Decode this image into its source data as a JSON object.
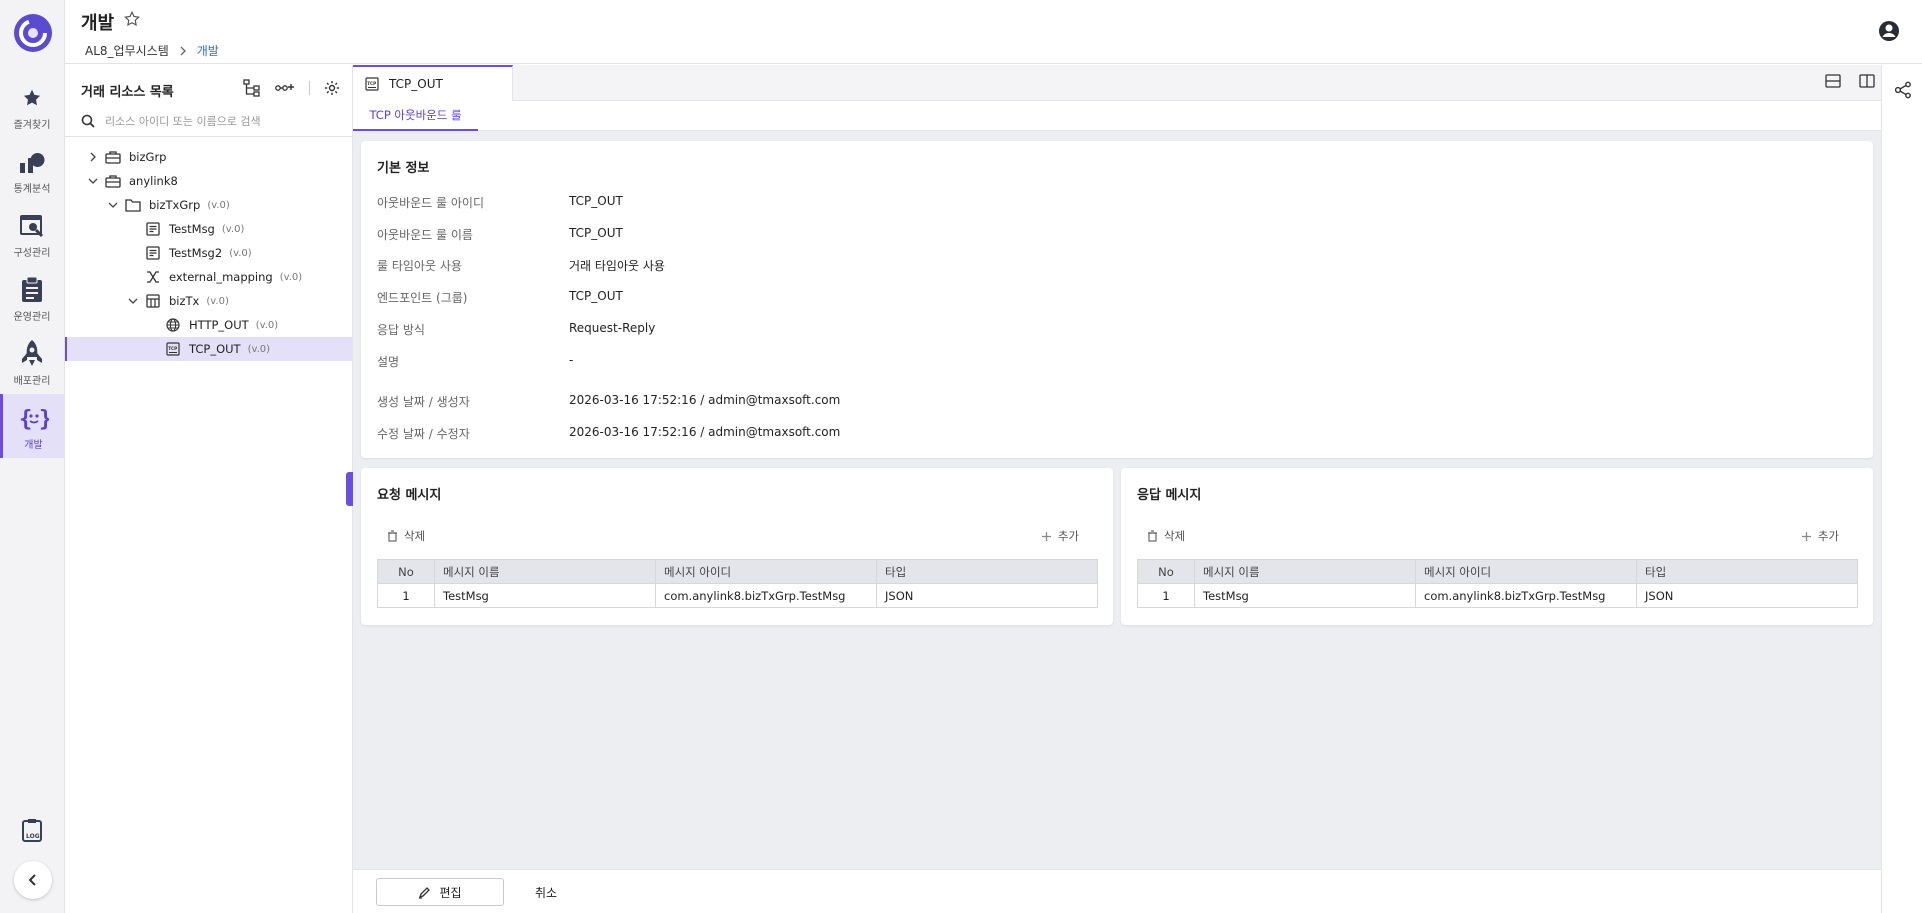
{
  "header": {
    "title": "개발",
    "breadcrumb": [
      "AL8_업무시스템",
      "개발"
    ]
  },
  "rail": {
    "items": [
      {
        "label": "즐겨찾기",
        "icon": "star-icon"
      },
      {
        "label": "통계분석",
        "icon": "chart-icon"
      },
      {
        "label": "구성관리",
        "icon": "config-icon"
      },
      {
        "label": "운영관리",
        "icon": "clipboard-icon"
      },
      {
        "label": "배포관리",
        "icon": "rocket-icon"
      },
      {
        "label": "개발",
        "icon": "code-icon"
      }
    ],
    "log_icon": "log-icon"
  },
  "tree": {
    "title": "거래 리소스 목록",
    "search_placeholder": "리소스 아이디 또는 이름으로 검색",
    "nodes": [
      {
        "name": "bizGrp",
        "version": ""
      },
      {
        "name": "anylink8",
        "version": ""
      },
      {
        "name": "bizTxGrp",
        "version": "(v.0)"
      },
      {
        "name": "TestMsg",
        "version": "(v.0)"
      },
      {
        "name": "TestMsg2",
        "version": "(v.0)"
      },
      {
        "name": "external_mapping",
        "version": "(v.0)"
      },
      {
        "name": "bizTx",
        "version": "(v.0)"
      },
      {
        "name": "HTTP_OUT",
        "version": "(v.0)"
      },
      {
        "name": "TCP_OUT",
        "version": "(v.0)"
      }
    ]
  },
  "tabs": {
    "active": "TCP_OUT",
    "subtab": "TCP 아웃바운드 룰"
  },
  "basic_info": {
    "title": "기본 정보",
    "rows": [
      {
        "label": "아웃바운드 룰 아이디",
        "value": "TCP_OUT"
      },
      {
        "label": "아웃바운드 룰 이름",
        "value": "TCP_OUT"
      },
      {
        "label": "룰 타임아웃 사용",
        "value": "거래 타임아웃 사용"
      },
      {
        "label": "엔드포인트 (그룹)",
        "value": "TCP_OUT"
      },
      {
        "label": "응답 방식",
        "value": "Request-Reply"
      },
      {
        "label": "설명",
        "value": "-"
      },
      {
        "label": "생성 날짜 / 생성자",
        "value": "2026-03-16 17:52:16 / admin@tmaxsoft.com"
      },
      {
        "label": "수정 날짜 / 수정자",
        "value": "2026-03-16 17:52:16 / admin@tmaxsoft.com"
      }
    ]
  },
  "request_msg": {
    "title": "요청 메시지",
    "delete_label": "삭제",
    "add_label": "추가",
    "columns": [
      "No",
      "메시지 이름",
      "메시지 아이디",
      "타입"
    ],
    "rows": [
      [
        "1",
        "TestMsg",
        "com.anylink8.bizTxGrp.TestMsg",
        "JSON"
      ]
    ]
  },
  "response_msg": {
    "title": "응답 메시지",
    "delete_label": "삭제",
    "add_label": "추가",
    "columns": [
      "No",
      "메시지 이름",
      "메시지 아이디",
      "타입"
    ],
    "rows": [
      [
        "1",
        "TestMsg",
        "com.anylink8.bizTxGrp.TestMsg",
        "JSON"
      ]
    ]
  },
  "footer": {
    "edit_label": "편집",
    "cancel_label": "취소"
  },
  "colors": {
    "accent": "#6b4de6",
    "link": "#2d6ed8"
  }
}
